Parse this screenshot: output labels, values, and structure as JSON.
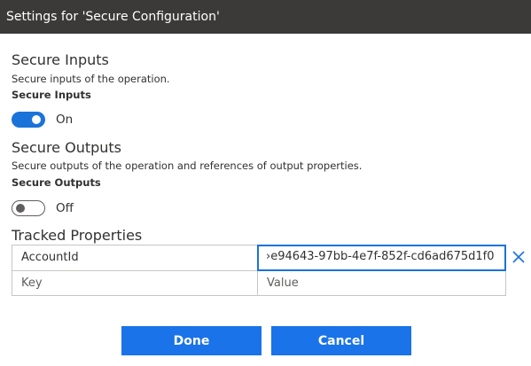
{
  "dialog": {
    "title": "Settings for 'Secure Configuration'"
  },
  "secure_inputs": {
    "heading": "Secure Inputs",
    "description": "Secure inputs of the operation.",
    "label": "Secure Inputs",
    "toggle_state": "On"
  },
  "secure_outputs": {
    "heading": "Secure Outputs",
    "description": "Secure outputs of the operation and references of output properties.",
    "label": "Secure Outputs",
    "toggle_state": "Off"
  },
  "tracked_properties": {
    "heading": "Tracked Properties",
    "rows": [
      {
        "key": "AccountId",
        "value": "›e94643-97bb-4e7f-852f-cd6ad675d1f0"
      },
      {
        "key_placeholder": "Key",
        "value_placeholder": "Value"
      }
    ]
  },
  "buttons": {
    "done": "Done",
    "cancel": "Cancel"
  },
  "colors": {
    "accent": "#1a73e8",
    "titlebar": "#3b3a39"
  }
}
